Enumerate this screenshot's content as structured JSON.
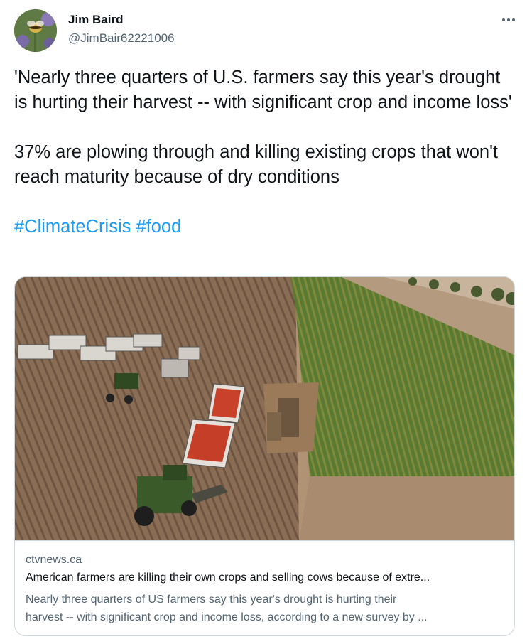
{
  "author": {
    "name": "Jim Baird",
    "handle": "@JimBair62221006",
    "avatar_icon": "bee-on-lavender-photo"
  },
  "tweet": {
    "paragraph1": "'Nearly three quarters of U.S. farmers say this year's drought is hurting their harvest -- with significant crop and income loss'",
    "paragraph2": "37% are plowing through and killing existing crops that won't reach maturity because of dry conditions",
    "hashtag1": "#ClimateCrisis",
    "hashtag2": "#food"
  },
  "card": {
    "image_icon": "harvest-field-photo",
    "domain": "ctvnews.ca",
    "title": "American farmers are killing their own crops and selling cows because of extre...",
    "description_line1": "Nearly three quarters of US farmers say this year's drought is hurting their",
    "description_line2": "harvest -- with significant crop and income loss, according to a new survey by ..."
  },
  "colors": {
    "link": "#1d9bf0",
    "secondary_text": "#536471",
    "primary_text": "#0f1419",
    "border": "#cfd9de"
  }
}
